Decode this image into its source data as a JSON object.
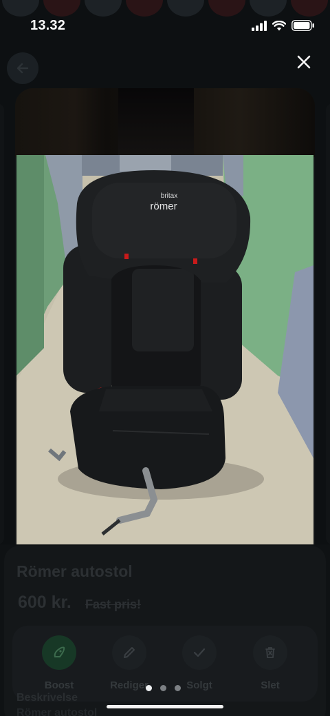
{
  "status_bar": {
    "time": "13.32"
  },
  "viewer": {
    "close_icon": "close-icon",
    "back_icon": "arrow-left-icon",
    "photo_brand_line1": "britax",
    "photo_brand_line2": "römer",
    "pager": {
      "count": 3,
      "active_index": 0
    }
  },
  "listing": {
    "title": "Römer autostol",
    "price": "600 kr.",
    "price_note": "Fast pris!",
    "actions": [
      {
        "label": "Boost",
        "icon": "rocket-icon"
      },
      {
        "label": "Rediger",
        "icon": "pencil-icon"
      },
      {
        "label": "Solgt",
        "icon": "check-icon"
      },
      {
        "label": "Slet",
        "icon": "trash-icon"
      }
    ],
    "description_heading": "Beskrivelse",
    "description_preview": "Römer autostol"
  },
  "colors": {
    "boost_green": "#173826",
    "background": "#0d1012"
  }
}
